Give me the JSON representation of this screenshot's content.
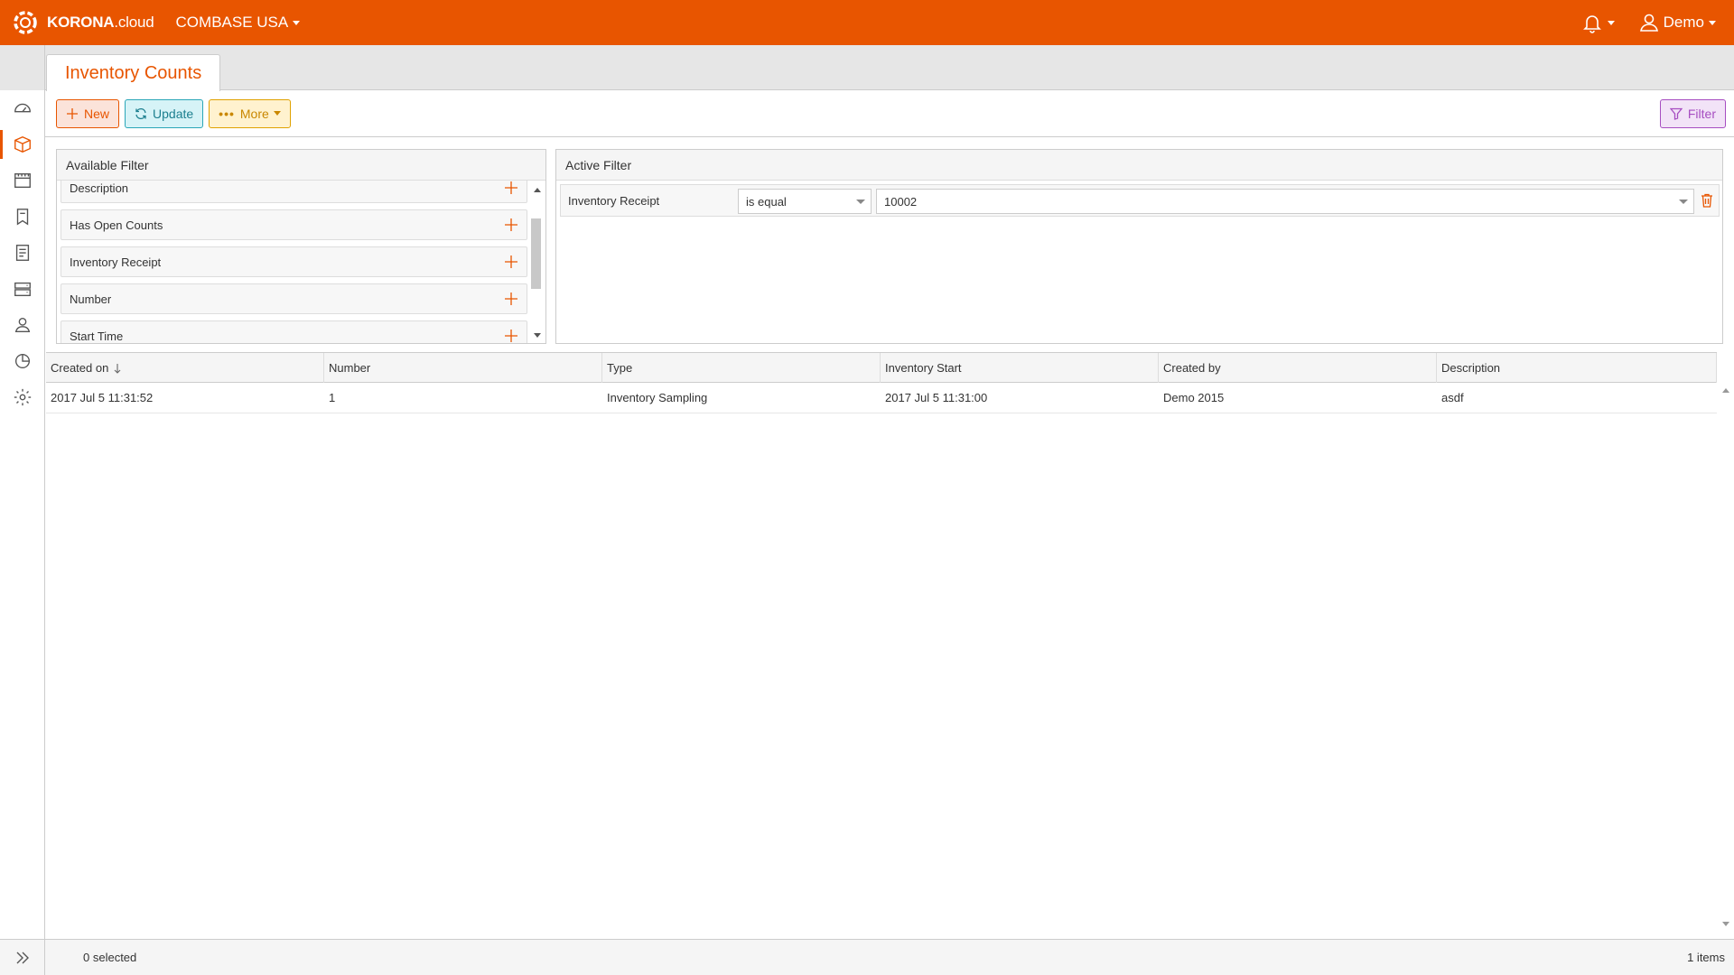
{
  "app": {
    "logo_brand": "KORONA",
    "logo_suffix": ".cloud",
    "company": "COMBASE USA",
    "user": "Demo"
  },
  "tab": {
    "title": "Inventory Counts"
  },
  "toolbar": {
    "new_label": "New",
    "update_label": "Update",
    "more_dots": "•••",
    "more_label": "More",
    "filter_label": "Filter"
  },
  "available_filter": {
    "title": "Available Filter",
    "items": [
      "Description",
      "Has Open Counts",
      "Inventory Receipt",
      "Number",
      "Start Time"
    ]
  },
  "active_filter": {
    "title": "Active Filter",
    "field": "Inventory Receipt",
    "operator": "is equal",
    "value": "10002"
  },
  "table": {
    "columns": [
      "Created on",
      "Number",
      "Type",
      "Inventory Start",
      "Created by",
      "Description"
    ],
    "rows": [
      [
        "2017 Jul 5 11:31:52",
        "1",
        "Inventory Sampling",
        "2017 Jul 5 11:31:00",
        "Demo 2015",
        "asdf"
      ]
    ]
  },
  "footer": {
    "selected": "0 selected",
    "items": "1 items"
  },
  "colors": {
    "brand": "#e85500",
    "new": "#e85500",
    "update": "#2aa6b8",
    "more": "#e0a100",
    "filter": "#a64dc1"
  }
}
